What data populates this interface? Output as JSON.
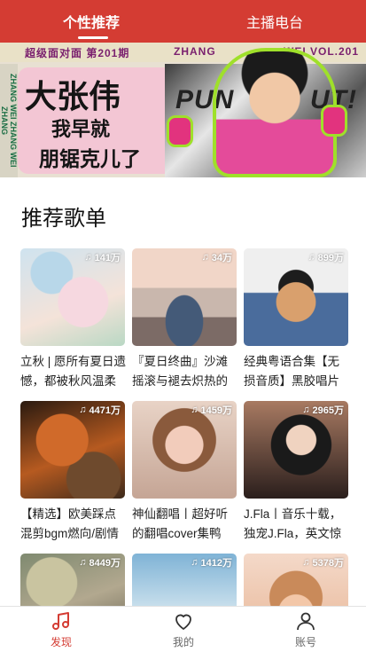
{
  "colors": {
    "accent": "#d43c33",
    "tab_text": "#ffffff",
    "nav_inactive": "#666666"
  },
  "top_tabs": [
    {
      "label": "个性推荐",
      "active": true
    },
    {
      "label": "主播电台",
      "active": false
    }
  ],
  "banner": {
    "strip_left": "超级面对面 第201期",
    "strip_mid": "ZHANG",
    "strip_right": "WEI VOL.201",
    "side_text": "ZHANG WEI ZHANG WEI ZHANG",
    "title_line1": "大张伟",
    "title_line2": "我早就",
    "title_line3": "朋锯克儿了",
    "punch_left": "PUN",
    "punch_right": "UT!"
  },
  "section": {
    "title": "推荐歌单"
  },
  "playlists": [
    {
      "count": "141万",
      "title": "立秋 | 愿所有夏日遗憾，都被秋风温柔"
    },
    {
      "count": "34万",
      "title": "『夏日终曲』沙滩摇滚与褪去炽热的余"
    },
    {
      "count": "899万",
      "title": "经典粤语合集【无损音质】黑胶唱片"
    },
    {
      "count": "4471万",
      "title": "【精选】欧美踩点混剪bgm燃向/剧情"
    },
    {
      "count": "1459万",
      "title": "神仙翻唱丨超好听的翻唱cover集鸭"
    },
    {
      "count": "2965万",
      "title": "J.Fla丨音乐十载，独宠J.Fla，英文惊艳"
    },
    {
      "count": "8449万",
      "title": ""
    },
    {
      "count": "1412万",
      "title": ""
    },
    {
      "count": "5378万",
      "title": ""
    }
  ],
  "icons": {
    "count": "music-note-icon",
    "discover": "music-note-icon",
    "mine": "heart-icon",
    "account": "user-icon"
  },
  "bottom_nav": [
    {
      "label": "发现",
      "active": true
    },
    {
      "label": "我的",
      "active": false
    },
    {
      "label": "账号",
      "active": false
    }
  ]
}
